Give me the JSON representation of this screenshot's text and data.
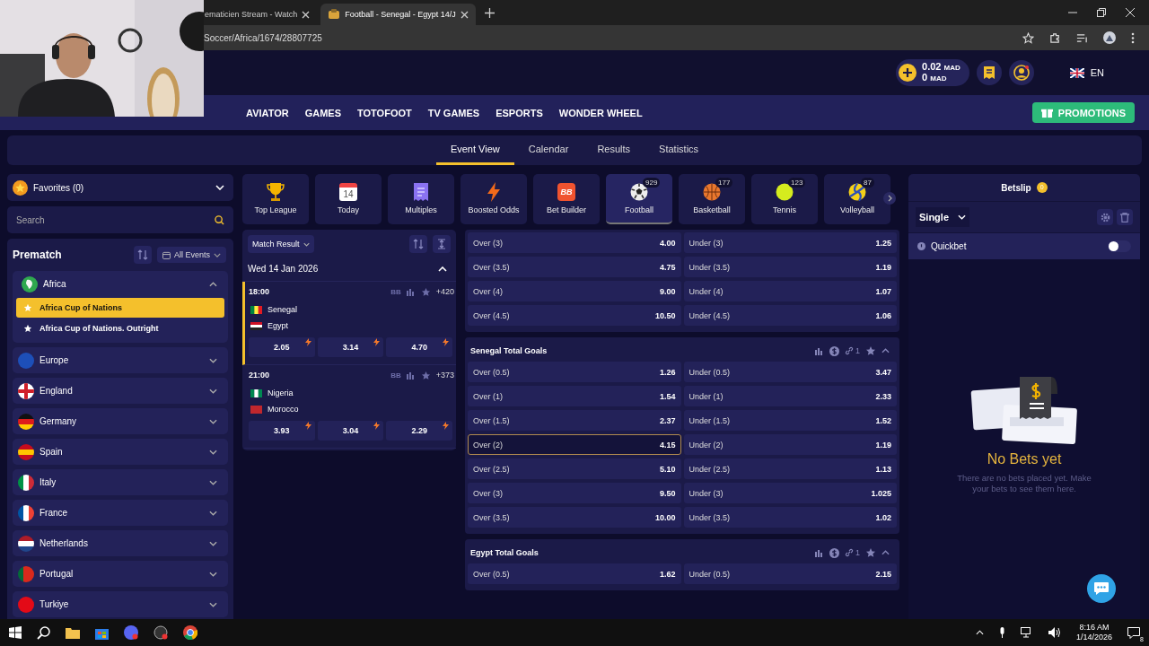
{
  "browser": {
    "tabs": [
      {
        "title": "ematicien Stream - Watch",
        "selected": false
      },
      {
        "title": "Football - Senegal - Egypt 14/J",
        "selected": true
      }
    ],
    "address": "Soccer/Africa/1674/28807725"
  },
  "header": {
    "balance": "0.02",
    "balance_currency": "MAD",
    "bonus": "0",
    "bonus_currency": "MAD",
    "language": "EN"
  },
  "nav": {
    "items": [
      "AVIATOR",
      "GAMES",
      "TOTOFOOT",
      "TV GAMES",
      "ESPORTS",
      "WONDER WHEEL"
    ],
    "promotions": "PROMOTIONS"
  },
  "subnav": [
    {
      "label": "Event View",
      "selected": true
    },
    {
      "label": "Calendar",
      "selected": false
    },
    {
      "label": "Results",
      "selected": false
    },
    {
      "label": "Statistics",
      "selected": false
    }
  ],
  "sidebar": {
    "favorites": "Favorites (0)",
    "search_placeholder": "Search",
    "prematch": "Prematch",
    "filter": "All Events",
    "regions": [
      {
        "name": "Africa",
        "expanded": true,
        "children": [
          {
            "name": "Africa Cup of Nations",
            "selected": true
          },
          {
            "name": "Africa Cup of Nations. Outright",
            "selected": false
          }
        ]
      },
      {
        "name": "Europe",
        "expanded": false
      },
      {
        "name": "England",
        "expanded": false
      },
      {
        "name": "Germany",
        "expanded": false
      },
      {
        "name": "Spain",
        "expanded": false
      },
      {
        "name": "Italy",
        "expanded": false
      },
      {
        "name": "France",
        "expanded": false
      },
      {
        "name": "Netherlands",
        "expanded": false
      },
      {
        "name": "Portugal",
        "expanded": false
      },
      {
        "name": "Turkiye",
        "expanded": false
      }
    ]
  },
  "categories": [
    {
      "label": "Top League",
      "selected": false
    },
    {
      "label": "Today",
      "icon_text": "14",
      "selected": false
    },
    {
      "label": "Multiples",
      "selected": false
    },
    {
      "label": "Boosted Odds",
      "selected": false
    },
    {
      "label": "Bet Builder",
      "icon_text": "BB",
      "selected": false
    },
    {
      "label": "Football",
      "count": "929",
      "selected": true
    },
    {
      "label": "Basketball",
      "count": "177",
      "selected": false
    },
    {
      "label": "Tennis",
      "count": "123",
      "selected": false
    },
    {
      "label": "Volleyball",
      "count": "87",
      "selected": false
    }
  ],
  "matches": {
    "market": "Match Result",
    "date": "Wed 14 Jan 2026",
    "list": [
      {
        "time": "18:00",
        "bb": "BB",
        "more": "+420",
        "home": "Senegal",
        "away": "Egypt",
        "odds": [
          "2.05",
          "3.14",
          "4.70"
        ],
        "selected": true
      },
      {
        "time": "21:00",
        "bb": "BB",
        "more": "+373",
        "home": "Nigeria",
        "away": "Morocco",
        "odds": [
          "3.93",
          "3.04",
          "2.29"
        ],
        "selected": false
      }
    ]
  },
  "markets": [
    {
      "rows": [
        {
          "over": "Over (3)",
          "over_odds": "4.00",
          "under": "Under (3)",
          "under_odds": "1.25",
          "over_selected": false
        },
        {
          "over": "Over (3.5)",
          "over_odds": "4.75",
          "under": "Under (3.5)",
          "under_odds": "1.19",
          "over_selected": false
        },
        {
          "over": "Over (4)",
          "over_odds": "9.00",
          "under": "Under (4)",
          "under_odds": "1.07",
          "over_selected": false
        },
        {
          "over": "Over (4.5)",
          "over_odds": "10.50",
          "under": "Under (4.5)",
          "under_odds": "1.06",
          "over_selected": false
        }
      ]
    },
    {
      "title": "Senegal Total Goals",
      "link_count": "1",
      "rows": [
        {
          "over": "Over (0.5)",
          "over_odds": "1.26",
          "under": "Under (0.5)",
          "under_odds": "3.47",
          "over_selected": false
        },
        {
          "over": "Over (1)",
          "over_odds": "1.54",
          "under": "Under (1)",
          "under_odds": "2.33",
          "over_selected": false
        },
        {
          "over": "Over (1.5)",
          "over_odds": "2.37",
          "under": "Under (1.5)",
          "under_odds": "1.52",
          "over_selected": false
        },
        {
          "over": "Over (2)",
          "over_odds": "4.15",
          "under": "Under (2)",
          "under_odds": "1.19",
          "over_selected": true
        },
        {
          "over": "Over (2.5)",
          "over_odds": "5.10",
          "under": "Under (2.5)",
          "under_odds": "1.13",
          "over_selected": false
        },
        {
          "over": "Over (3)",
          "over_odds": "9.50",
          "under": "Under (3)",
          "under_odds": "1.025",
          "over_selected": false
        },
        {
          "over": "Over (3.5)",
          "over_odds": "10.00",
          "under": "Under (3.5)",
          "under_odds": "1.02",
          "over_selected": false
        }
      ]
    },
    {
      "title": "Egypt Total Goals",
      "link_count": "1",
      "rows": [
        {
          "over": "Over (0.5)",
          "over_odds": "1.62",
          "under": "Under (0.5)",
          "under_odds": "2.15",
          "over_selected": false
        }
      ]
    }
  ],
  "betslip": {
    "title": "Betslip",
    "count": "0",
    "type": "Single",
    "quickbet": "Quickbet",
    "quickbet_on": false,
    "empty_title": "No Bets yet",
    "empty_text": "There are no bets placed yet. Make your bets to see them here."
  },
  "taskbar": {
    "time": "8:16 AM",
    "date": "1/14/2026",
    "notifications": "8"
  }
}
